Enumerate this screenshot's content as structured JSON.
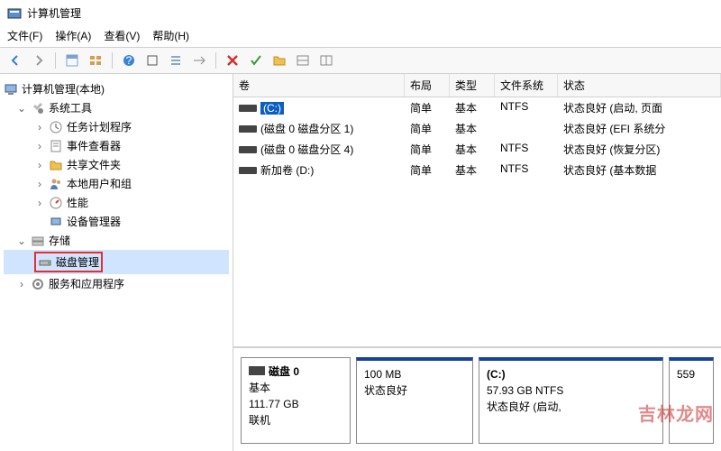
{
  "window": {
    "title": "计算机管理"
  },
  "menu": {
    "file": "文件(F)",
    "action": "操作(A)",
    "view": "查看(V)",
    "help": "帮助(H)"
  },
  "tree": {
    "root": "计算机管理(本地)",
    "system_tools": "系统工具",
    "task_scheduler": "任务计划程序",
    "event_viewer": "事件查看器",
    "shared_folders": "共享文件夹",
    "local_users": "本地用户和组",
    "performance": "性能",
    "device_manager": "设备管理器",
    "storage": "存储",
    "disk_management": "磁盘管理",
    "services_apps": "服务和应用程序"
  },
  "columns": {
    "volume": "卷",
    "layout": "布局",
    "type": "类型",
    "filesystem": "文件系统",
    "status": "状态"
  },
  "volumes": [
    {
      "name": "(C:)",
      "layout": "简单",
      "type": "基本",
      "fs": "NTFS",
      "status": "状态良好 (启动, 页面",
      "selected": true
    },
    {
      "name": "(磁盘 0 磁盘分区 1)",
      "layout": "简单",
      "type": "基本",
      "fs": "",
      "status": "状态良好 (EFI 系统分"
    },
    {
      "name": "(磁盘 0 磁盘分区 4)",
      "layout": "简单",
      "type": "基本",
      "fs": "NTFS",
      "status": "状态良好 (恢复分区)"
    },
    {
      "name": "新加卷 (D:)",
      "layout": "简单",
      "type": "基本",
      "fs": "NTFS",
      "status": "状态良好 (基本数据"
    }
  ],
  "disk": {
    "label": "磁盘 0",
    "type": "基本",
    "size": "111.77 GB",
    "status": "联机",
    "partitions": [
      {
        "title": "",
        "line1": "100 MB",
        "line2": "状态良好"
      },
      {
        "title": "(C:)",
        "line1": "57.93 GB NTFS",
        "line2": "状态良好 (启动,"
      },
      {
        "title": "",
        "line1": "559",
        "line2": ""
      }
    ]
  },
  "watermark": "吉林龙网"
}
